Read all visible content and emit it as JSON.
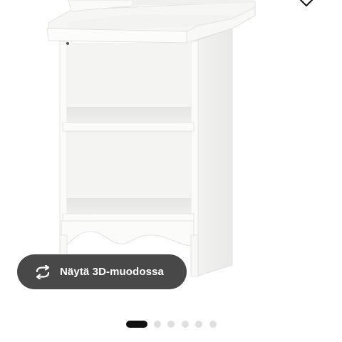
{
  "product": {
    "image_icon": "changing-table-bookcase-image"
  },
  "favourite": {
    "icon": "heart-outline-icon"
  },
  "viewer": {
    "button_label": "Näytä 3D-muodossa",
    "button_icon": "rotate-arrows-icon",
    "button_color": "#484848"
  },
  "carousel": {
    "total_slides": 6,
    "active_index": 0,
    "active_color": "#111111",
    "inactive_color": "#dfdfdf"
  }
}
